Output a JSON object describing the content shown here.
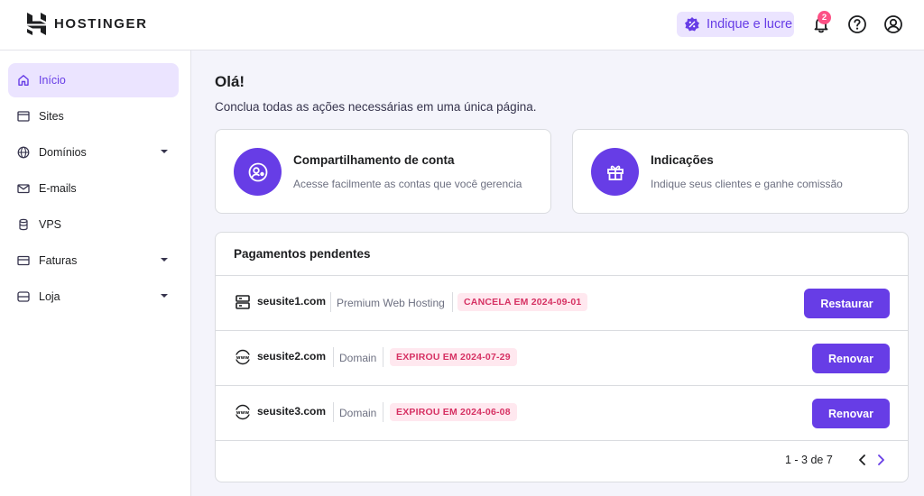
{
  "header": {
    "brand": "HOSTINGER",
    "refer_label": "Indique e lucre",
    "notification_count": "2",
    "icons": [
      "hostinger-logo-icon",
      "percent-badge-icon",
      "bell-icon",
      "help-circle-icon",
      "user-circle-icon"
    ]
  },
  "sidebar": {
    "items": [
      {
        "label": "Início",
        "icon": "home-icon",
        "active": true
      },
      {
        "label": "Sites",
        "icon": "browser-icon"
      },
      {
        "label": "Domínios",
        "icon": "globe-icon",
        "expandable": true
      },
      {
        "label": "E-mails",
        "icon": "mail-icon"
      },
      {
        "label": "VPS",
        "icon": "server-stack-icon"
      },
      {
        "label": "Faturas",
        "icon": "card-icon",
        "expandable": true
      },
      {
        "label": "Loja",
        "icon": "store-icon",
        "expandable": true
      }
    ]
  },
  "main": {
    "greeting": "Olá!",
    "subtitle": "Conclua todas as ações necessárias em uma única página.",
    "cards": [
      {
        "title": "Compartilhamento de conta",
        "description": "Acesse facilmente as contas que você gerencia",
        "icon": "account-share-icon"
      },
      {
        "title": "Indicações",
        "description": "Indique seus clientes e ganhe comissão",
        "icon": "gift-icon"
      }
    ],
    "payments": {
      "title": "Pagamentos pendentes",
      "rows": [
        {
          "domain": "seusite1.com",
          "type": "Premium Web Hosting",
          "tag": "CANCELA EM 2024-09-01",
          "action": "Restaurar",
          "icon": "server-icon"
        },
        {
          "domain": "seusite2.com",
          "type": "Domain",
          "tag": "EXPIROU EM 2024-07-29",
          "action": "Renovar",
          "icon": "www-icon"
        },
        {
          "domain": "seusite3.com",
          "type": "Domain",
          "tag": "EXPIROU EM 2024-06-08",
          "action": "Renovar",
          "icon": "www-icon"
        }
      ],
      "pagination": "1 - 3 de 7"
    }
  },
  "colors": {
    "accent": "#673de6",
    "accent_light": "#ebe4ff",
    "danger": "#d63163",
    "danger_bg": "#ffe8ef",
    "page_bg": "#f4f4fb"
  }
}
